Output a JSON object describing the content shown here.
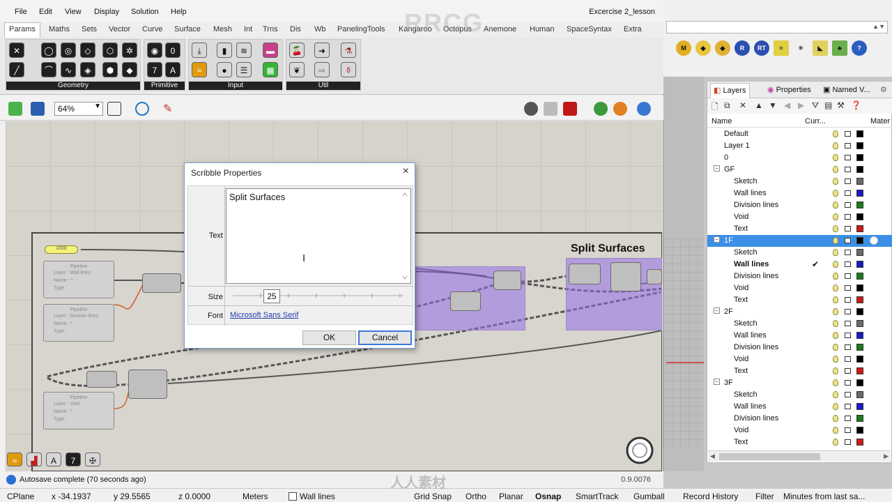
{
  "grasshopper": {
    "menu": [
      "File",
      "Edit",
      "View",
      "Display",
      "Solution",
      "Help"
    ],
    "document_name": "Excercise 2_lesson",
    "tabs": [
      "Params",
      "Maths",
      "Sets",
      "Vector",
      "Curve",
      "Surface",
      "Mesh",
      "Int",
      "Trns",
      "Dis",
      "Wb",
      "PanelingTools",
      "Kangaroo",
      "Octopus",
      "Anemone",
      "Human",
      "SpaceSyntax",
      "Extra"
    ],
    "active_tab": "Params",
    "ribbon_groups": [
      "Geometry",
      "Primitive",
      "Input",
      "Util"
    ],
    "zoom": "64%",
    "canvas": {
      "group_title": "Split Surfaces",
      "toggle_label": "1000",
      "pipelines": [
        {
          "title": "Pipeline",
          "layer": "Layer : Wall lines",
          "name": "Name : *",
          "type": "Type :"
        },
        {
          "title": "Pipeline",
          "layer": "Layer : Division lines",
          "name": "Name : *",
          "type": "Type :"
        },
        {
          "title": "Pipeline",
          "layer": "Layer : Void",
          "name": "Name : *",
          "type": "Type :"
        }
      ]
    },
    "status": {
      "autosave": "Autosave complete (70 seconds ago)",
      "version": "0.9.0076"
    }
  },
  "dialog": {
    "title": "Scribble Properties",
    "close": "×",
    "text_label": "Text",
    "text_value": "Split Surfaces",
    "size_label": "Size",
    "size_value": "25",
    "font_label": "Font",
    "font_value": "Microsoft Sans Serif",
    "ok": "OK",
    "cancel": "Cancel"
  },
  "panel": {
    "tabs": [
      "Layers",
      "Properties",
      "Named V..."
    ],
    "headers": {
      "name": "Name",
      "current": "Curr...",
      "material": "Mater"
    },
    "layers": [
      {
        "name": "Default",
        "indent": 1,
        "color": "#000000"
      },
      {
        "name": "Layer 1",
        "indent": 1,
        "color": "#000000"
      },
      {
        "name": "0",
        "indent": 1,
        "color": "#000000"
      },
      {
        "name": "GF",
        "indent": 1,
        "expander": "−",
        "color": "#000000"
      },
      {
        "name": "Sketch",
        "indent": 2,
        "color": "#6a6a6a"
      },
      {
        "name": "Wall lines",
        "indent": 2,
        "color": "#1a1ac8"
      },
      {
        "name": "Division lines",
        "indent": 2,
        "color": "#1a7a1a"
      },
      {
        "name": "Void",
        "indent": 2,
        "color": "#000000"
      },
      {
        "name": "Text",
        "indent": 2,
        "color": "#d01818"
      },
      {
        "name": "1F",
        "indent": 1,
        "expander": "−",
        "color": "#000000",
        "selected": true
      },
      {
        "name": "Sketch",
        "indent": 2,
        "color": "#6a6a6a"
      },
      {
        "name": "Wall lines",
        "indent": 2,
        "color": "#1a1ac8",
        "current": true,
        "bold": true
      },
      {
        "name": "Division lines",
        "indent": 2,
        "color": "#1a7a1a"
      },
      {
        "name": "Void",
        "indent": 2,
        "color": "#000000"
      },
      {
        "name": "Text",
        "indent": 2,
        "color": "#d01818"
      },
      {
        "name": "2F",
        "indent": 1,
        "expander": "−",
        "color": "#000000"
      },
      {
        "name": "Sketch",
        "indent": 2,
        "color": "#6a6a6a"
      },
      {
        "name": "Wall lines",
        "indent": 2,
        "color": "#1a1ac8"
      },
      {
        "name": "Division lines",
        "indent": 2,
        "color": "#1a7a1a"
      },
      {
        "name": "Void",
        "indent": 2,
        "color": "#000000"
      },
      {
        "name": "Text",
        "indent": 2,
        "color": "#d01818"
      },
      {
        "name": "3F",
        "indent": 1,
        "expander": "−",
        "color": "#000000"
      },
      {
        "name": "Sketch",
        "indent": 2,
        "color": "#6a6a6a"
      },
      {
        "name": "Wall lines",
        "indent": 2,
        "color": "#1a1ac8"
      },
      {
        "name": "Division lines",
        "indent": 2,
        "color": "#1a7a1a"
      },
      {
        "name": "Void",
        "indent": 2,
        "color": "#000000"
      },
      {
        "name": "Text",
        "indent": 2,
        "color": "#d01818"
      }
    ],
    "check_mark": "✔"
  },
  "rhino_status": {
    "cplane": "CPlane",
    "x": "x -34.1937",
    "y": "y 29.5565",
    "z": "z 0.0000",
    "units": "Meters",
    "layer": "Wall lines",
    "grid_snap": "Grid Snap",
    "ortho": "Ortho",
    "planar": "Planar",
    "osnap": "Osnap",
    "smarttrack": "SmartTrack",
    "gumball": "Gumball",
    "record_history": "Record History",
    "filter": "Filter",
    "minutes": "Minutes from last sa..."
  },
  "watermark": "RRCG",
  "watermark_bottom": "人人素材"
}
